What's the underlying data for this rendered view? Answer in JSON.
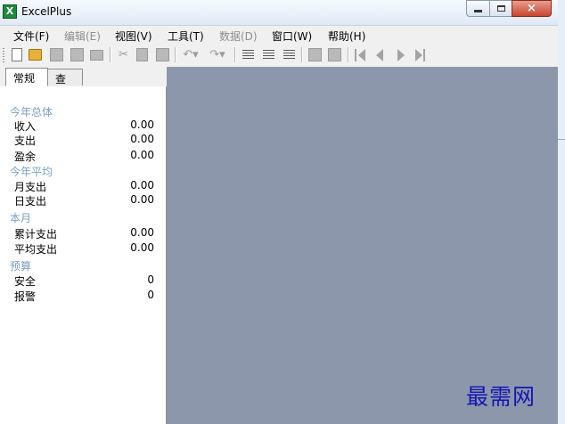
{
  "window": {
    "title": "ExcelPlus",
    "icon_letter": "X"
  },
  "window_controls": {
    "minimize": "minimize",
    "maximize": "maximize",
    "close": "×"
  },
  "menu": [
    {
      "label": "文件(F)",
      "enabled": true
    },
    {
      "label": "编辑(E)",
      "enabled": false
    },
    {
      "label": "视图(V)",
      "enabled": true
    },
    {
      "label": "工具(T)",
      "enabled": true
    },
    {
      "label": "数据(D)",
      "enabled": false
    },
    {
      "label": "窗口(W)",
      "enabled": true
    },
    {
      "label": "帮助(H)",
      "enabled": true
    }
  ],
  "toolbar": [
    "new-document-icon",
    "open-folder-icon",
    "save-icon",
    "save-all-icon",
    "print-icon",
    "cut-icon",
    "copy-icon",
    "paste-icon",
    "undo-icon",
    "redo-icon",
    "align-left-icon",
    "align-center-icon",
    "align-right-icon",
    "export-icon",
    "import-icon",
    "first-record-icon",
    "previous-record-icon",
    "next-record-icon",
    "last-record-icon"
  ],
  "tabs": [
    {
      "label": "常规"
    },
    {
      "label": "查账"
    }
  ],
  "summary": {
    "year_total": {
      "title": "今年总体",
      "rows": [
        {
          "label": "收入",
          "value": "0.00"
        },
        {
          "label": "支出",
          "value": "0.00"
        },
        {
          "label": "盈余",
          "value": "0.00"
        }
      ]
    },
    "year_average": {
      "title": "今年平均",
      "rows": [
        {
          "label": "月支出",
          "value": "0.00"
        },
        {
          "label": "日支出",
          "value": "0.00"
        }
      ]
    },
    "this_month": {
      "title": "本月",
      "rows": [
        {
          "label": "累计支出",
          "value": "0.00"
        },
        {
          "label": "平均支出",
          "value": "0.00"
        }
      ]
    },
    "budget": {
      "title": "预算",
      "rows": [
        {
          "label": "安全",
          "value": "0"
        },
        {
          "label": "报警",
          "value": "0"
        }
      ]
    }
  },
  "watermark": "最需网",
  "colors": {
    "workspace": "#8d97ab",
    "section_title": "#7c9ec3",
    "close_button": "#c8452f"
  }
}
